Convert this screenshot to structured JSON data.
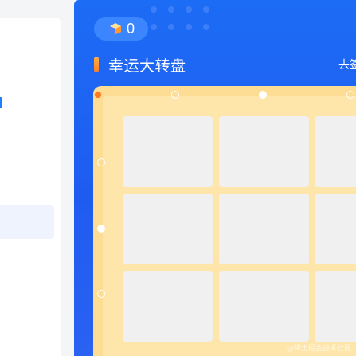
{
  "header": {
    "points_value": "0",
    "ore_icon": "ore-coin-icon",
    "title": "幸运大转盘",
    "signin_label": "去签"
  },
  "board": {
    "cells": [
      "",
      "",
      "",
      "",
      "",
      "",
      "",
      "",
      ""
    ]
  },
  "watermark": "@稀土掘金技术社区",
  "colors": {
    "panel_blue": "#1d6cf5",
    "board_gold": "#fddc93",
    "accent_orange": "#ff7a1a"
  }
}
